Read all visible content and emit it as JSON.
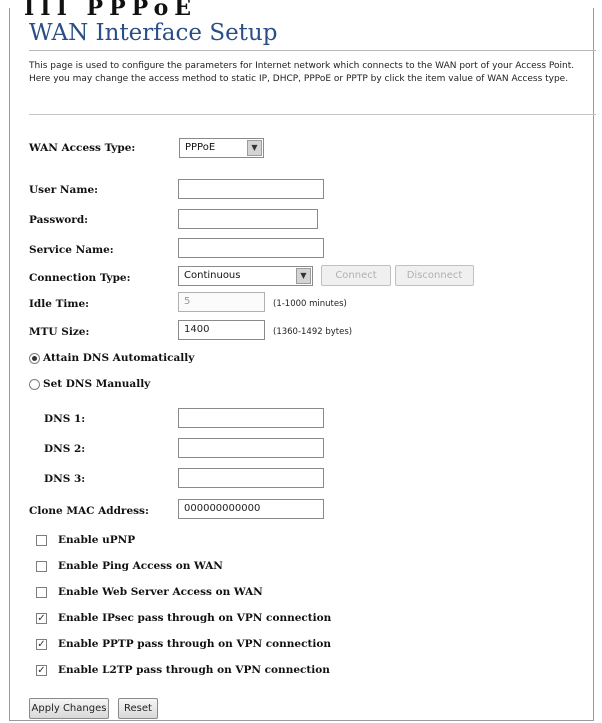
{
  "cut_heading": "III PPPoE",
  "title": "WAN Interface Setup",
  "description": "This page is used to configure the parameters for Internet network which connects to the WAN port of your Access Point. Here you may change the access method to static IP, DHCP, PPPoE or PPTP by click the item value of WAN Access type.",
  "wan_access_type": {
    "label": "WAN Access Type:",
    "value": "PPPoE"
  },
  "user_name": {
    "label": "User Name:",
    "value": ""
  },
  "password": {
    "label": "Password:",
    "value": ""
  },
  "service_name": {
    "label": "Service Name:",
    "value": ""
  },
  "connection_type": {
    "label": "Connection Type:",
    "value": "Continuous",
    "connect_label": "Connect",
    "disconnect_label": "Disconnect"
  },
  "idle_time": {
    "label": "Idle Time:",
    "value": "5",
    "hint": "(1-1000 minutes)"
  },
  "mtu_size": {
    "label": "MTU Size:",
    "value": "1400",
    "hint": "(1360-1492 bytes)"
  },
  "dns_auto": {
    "label": "Attain DNS Automatically",
    "selected": true
  },
  "dns_manual": {
    "label": "Set DNS Manually",
    "selected": false
  },
  "dns1": {
    "label": "DNS 1:",
    "value": ""
  },
  "dns2": {
    "label": "DNS 2:",
    "value": ""
  },
  "dns3": {
    "label": "DNS 3:",
    "value": ""
  },
  "clone_mac": {
    "label": "Clone MAC Address:",
    "value": "000000000000"
  },
  "options": [
    {
      "label": "Enable uPNP",
      "checked": false
    },
    {
      "label": "Enable Ping Access on WAN",
      "checked": false
    },
    {
      "label": "Enable Web Server Access on WAN",
      "checked": false
    },
    {
      "label": "Enable IPsec pass through on VPN connection",
      "checked": true
    },
    {
      "label": "Enable PPTP pass through on VPN connection",
      "checked": true
    },
    {
      "label": "Enable L2TP pass through on VPN connection",
      "checked": true
    }
  ],
  "apply_label": "Apply Changes",
  "reset_label": "Reset"
}
